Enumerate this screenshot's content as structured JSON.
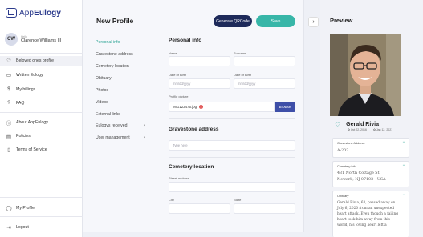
{
  "brand": {
    "name_prefix": "App",
    "name_suffix": "Eulogy"
  },
  "user": {
    "initials": "CW",
    "small_label": "Hello",
    "name": "Clarence Williams III"
  },
  "nav_top": [
    {
      "label": "Beloved ones profile",
      "icon": "heart-icon",
      "glyph": "♡"
    },
    {
      "label": "Written Eulogy",
      "icon": "book-icon",
      "glyph": "▭"
    },
    {
      "label": "My billings",
      "icon": "dollar-icon",
      "glyph": "$"
    },
    {
      "label": "FAQ",
      "icon": "question-icon",
      "glyph": "?"
    }
  ],
  "nav_mid": [
    {
      "label": "About AppEulogy",
      "icon": "info-icon",
      "glyph": "ⓘ"
    },
    {
      "label": "Policies",
      "icon": "policy-icon",
      "glyph": "▤"
    },
    {
      "label": "Terms of Service",
      "icon": "document-icon",
      "glyph": "▯"
    }
  ],
  "nav_bottom": [
    {
      "label": "My Profile",
      "icon": "user-icon",
      "glyph": "◯"
    },
    {
      "label": "Logout",
      "icon": "logout-icon",
      "glyph": "⇥"
    }
  ],
  "main": {
    "title": "New Profile",
    "qr_button": "Generate QRCode",
    "save_button": "Save",
    "sections": [
      {
        "label": "Personal info",
        "active": true
      },
      {
        "label": "Gravestone address"
      },
      {
        "label": "Cemetery location"
      },
      {
        "label": "Obituary"
      },
      {
        "label": "Photos"
      },
      {
        "label": "Videos"
      },
      {
        "label": "External links"
      },
      {
        "label": "Eulogys received",
        "chevron": "›"
      },
      {
        "label": "User management",
        "chevron": "›"
      }
    ],
    "form": {
      "personal_heading": "Personal info",
      "name_label": "Name",
      "surname_label": "Surname",
      "dob_label": "Date of Birth",
      "dob_placeholder": "mm/dd/yyyy",
      "dod_label": "Date of Birth",
      "dod_placeholder": "mm/dd/yyyy",
      "picture_label": "Profile picture",
      "picture_file": "IMG123475.jpg",
      "browse_label": "Browse",
      "gravestone_heading": "Gravestone address",
      "gravestone_placeholder": "Type here",
      "cemetery_heading": "Cemetery location",
      "street_label": "Street address",
      "city_label": "City",
      "state_label": "State"
    }
  },
  "preview": {
    "title": "Preview",
    "name": "Gerald Rivia",
    "born": "Oct 22, 2016",
    "died": "Jan 12, 2021",
    "gravestone_title": "Gravestone Address",
    "gravestone_value": "A-203",
    "cemetery_title": "Cemetery info",
    "cemetery_line1": "431 North Cottage St.",
    "cemetery_line2": "Newark, NJ 07103 - USA",
    "obituary_title": "Obituary",
    "obituary_lines": [
      "Gerald Rivia, 63, passed away on",
      "July 6, 2020 from an unexpected",
      "heart attack. Even though a failing",
      "heart took him away from this",
      "world, his loving heart left a"
    ]
  },
  "colors": {
    "accent": "#38b6a8",
    "navy": "#1e2a5a",
    "brand": "#2b3a8c",
    "browse": "#3e4fa8"
  }
}
